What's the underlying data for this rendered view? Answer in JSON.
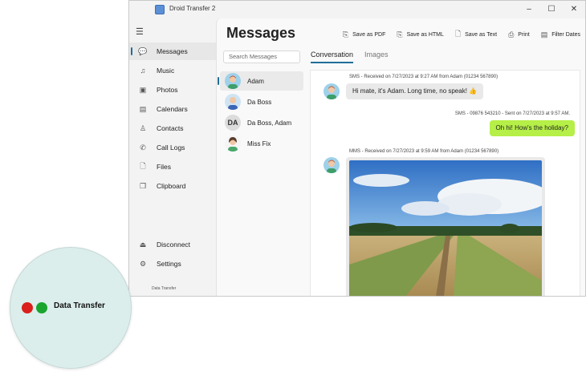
{
  "window": {
    "title": "Droid Transfer 2",
    "controls": {
      "minimize": "–",
      "maximize": "☐",
      "close": "✕"
    }
  },
  "sidebar": {
    "menu_icon": "hamburger-icon",
    "items": [
      {
        "label": "Messages",
        "icon": "messages-icon",
        "active": true
      },
      {
        "label": "Music",
        "icon": "music-icon"
      },
      {
        "label": "Photos",
        "icon": "photos-icon"
      },
      {
        "label": "Calendars",
        "icon": "calendar-icon"
      },
      {
        "label": "Contacts",
        "icon": "contacts-icon"
      },
      {
        "label": "Call Logs",
        "icon": "phone-icon"
      },
      {
        "label": "Files",
        "icon": "file-icon"
      },
      {
        "label": "Clipboard",
        "icon": "clipboard-icon"
      }
    ],
    "bottom_items": [
      {
        "label": "Disconnect",
        "icon": "eject-icon"
      },
      {
        "label": "Settings",
        "icon": "gear-icon"
      }
    ],
    "status_text": "Data Transfer"
  },
  "main": {
    "title": "Messages",
    "toolbar": [
      {
        "label": "Save as PDF",
        "icon": "pdf-icon"
      },
      {
        "label": "Save as HTML",
        "icon": "html-icon"
      },
      {
        "label": "Save as Text",
        "icon": "text-file-icon"
      },
      {
        "label": "Print",
        "icon": "printer-icon"
      },
      {
        "label": "Filter Dates",
        "icon": "calendar-filter-icon"
      }
    ],
    "search_placeholder": "Search Messages",
    "contacts": [
      {
        "name": "Adam",
        "active": true
      },
      {
        "name": "Da Boss"
      },
      {
        "name": "Da Boss, Adam",
        "initials": "DA"
      },
      {
        "name": "Miss Fix"
      }
    ],
    "tabs": [
      {
        "label": "Conversation",
        "active": true
      },
      {
        "label": "Images"
      }
    ],
    "messages": [
      {
        "meta": "SMS - Received on 7/27/2023 at 9:27 AM from Adam (01234 567890)",
        "text": "Hi mate, it's Adam. Long time, no speak! 👍",
        "direction": "in"
      },
      {
        "meta": "SMS - 09876 543210 - Sent on 7/27/2023 at 9:57 AM.",
        "text": "Oh hi! How's the holiday?",
        "direction": "out"
      },
      {
        "meta": "MMS - Received on 7/27/2023 at 9:59 AM from Adam (01234 567890)",
        "direction": "in",
        "attachment": "photo"
      }
    ]
  },
  "callout": {
    "label": "Data Transfer",
    "dots": [
      "#d9201c",
      "#1aa52f"
    ]
  },
  "colors": {
    "accent": "#1f6e9b",
    "sent_bubble": "#b5ef47",
    "received_bubble": "#e9e9e9"
  }
}
